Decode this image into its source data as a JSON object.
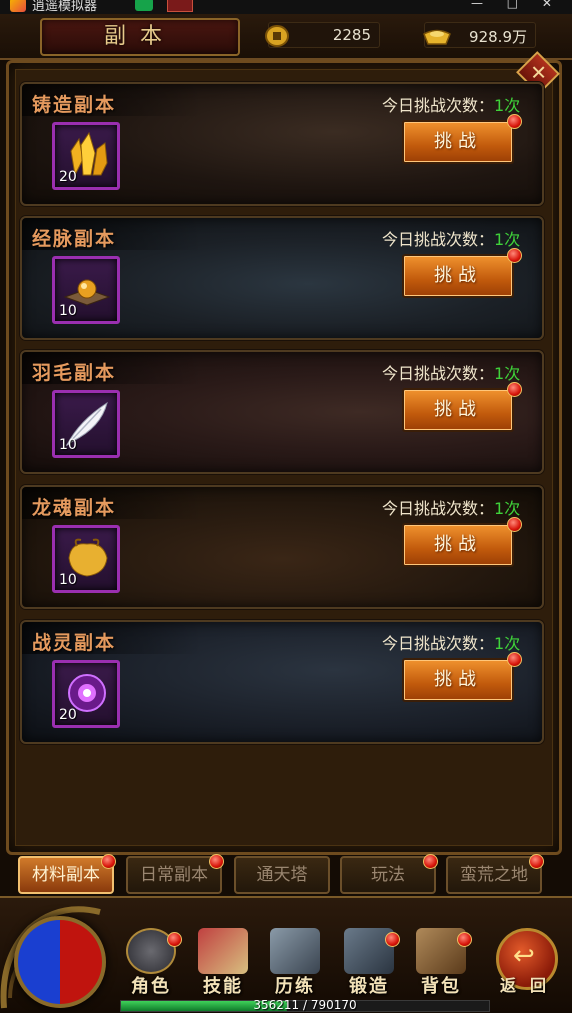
{
  "status_bar": {
    "app_text": "逍遥模拟器",
    "right_text": "— □ ✕"
  },
  "header": {
    "title": "副本",
    "coins": "2285",
    "ingots": "928.9万"
  },
  "close_label": "✕",
  "dungeons": [
    {
      "name": "铸造副本",
      "count_label": "今日挑战次数：",
      "count": "1次",
      "item_qty": "20",
      "button": "挑战",
      "item_icon": "crystal-icon"
    },
    {
      "name": "经脉副本",
      "count_label": "今日挑战次数：",
      "count": "1次",
      "item_qty": "10",
      "button": "挑战",
      "item_icon": "orb-icon"
    },
    {
      "name": "羽毛副本",
      "count_label": "今日挑战次数：",
      "count": "1次",
      "item_qty": "10",
      "button": "挑战",
      "item_icon": "feather-icon"
    },
    {
      "name": "龙魂副本",
      "count_label": "今日挑战次数：",
      "count": "1次",
      "item_qty": "10",
      "button": "挑战",
      "item_icon": "dragon-soul-icon"
    },
    {
      "name": "战灵副本",
      "count_label": "今日挑战次数：",
      "count": "1次",
      "item_qty": "20",
      "button": "挑战",
      "item_icon": "spirit-orb-icon"
    }
  ],
  "tabs": [
    {
      "label": "材料副本",
      "active": true
    },
    {
      "label": "日常副本",
      "active": false
    },
    {
      "label": "通天塔",
      "active": false
    },
    {
      "label": "玩法",
      "active": false
    },
    {
      "label": "蛮荒之地",
      "active": false
    }
  ],
  "nav": [
    {
      "label": "角色"
    },
    {
      "label": "技能"
    },
    {
      "label": "历练"
    },
    {
      "label": "锻造"
    },
    {
      "label": "背包"
    }
  ],
  "back_label": "返回",
  "exp": {
    "text": "356211 / 790170",
    "fraction": 0.4508
  },
  "colors": {
    "count_green": "#3fd23a",
    "name_orange": "#e59a5e",
    "button_orange": "#d9761e"
  }
}
